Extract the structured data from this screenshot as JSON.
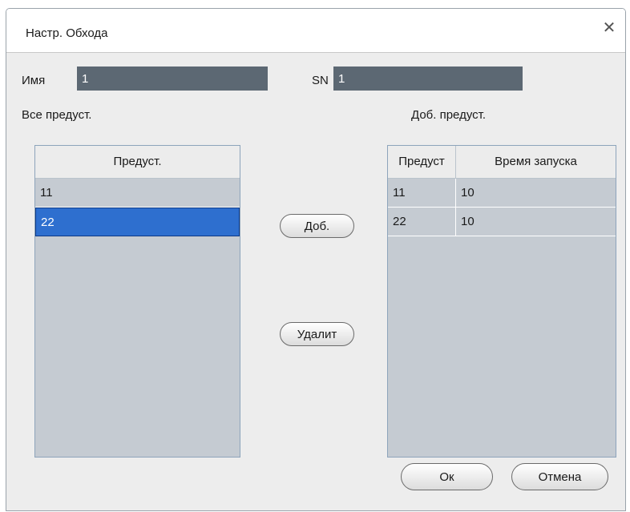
{
  "dialog": {
    "title": "Настр. Обхода",
    "close_label": "✕"
  },
  "form": {
    "name_label": "Имя",
    "name_value": "1",
    "sn_label": "SN",
    "sn_value": "1"
  },
  "all_presets": {
    "label": "Все предуст.",
    "header": "Предуст.",
    "rows": [
      "11",
      "22"
    ]
  },
  "added_presets": {
    "label": "Доб. предуст.",
    "headers": [
      "Предуст",
      "Время запуска"
    ],
    "rows": [
      {
        "preset": "11",
        "time": "10"
      },
      {
        "preset": "22",
        "time": "10"
      }
    ]
  },
  "buttons": {
    "add": "Доб.",
    "delete": "Удалит",
    "ok": "Ок",
    "cancel": "Отмена"
  }
}
